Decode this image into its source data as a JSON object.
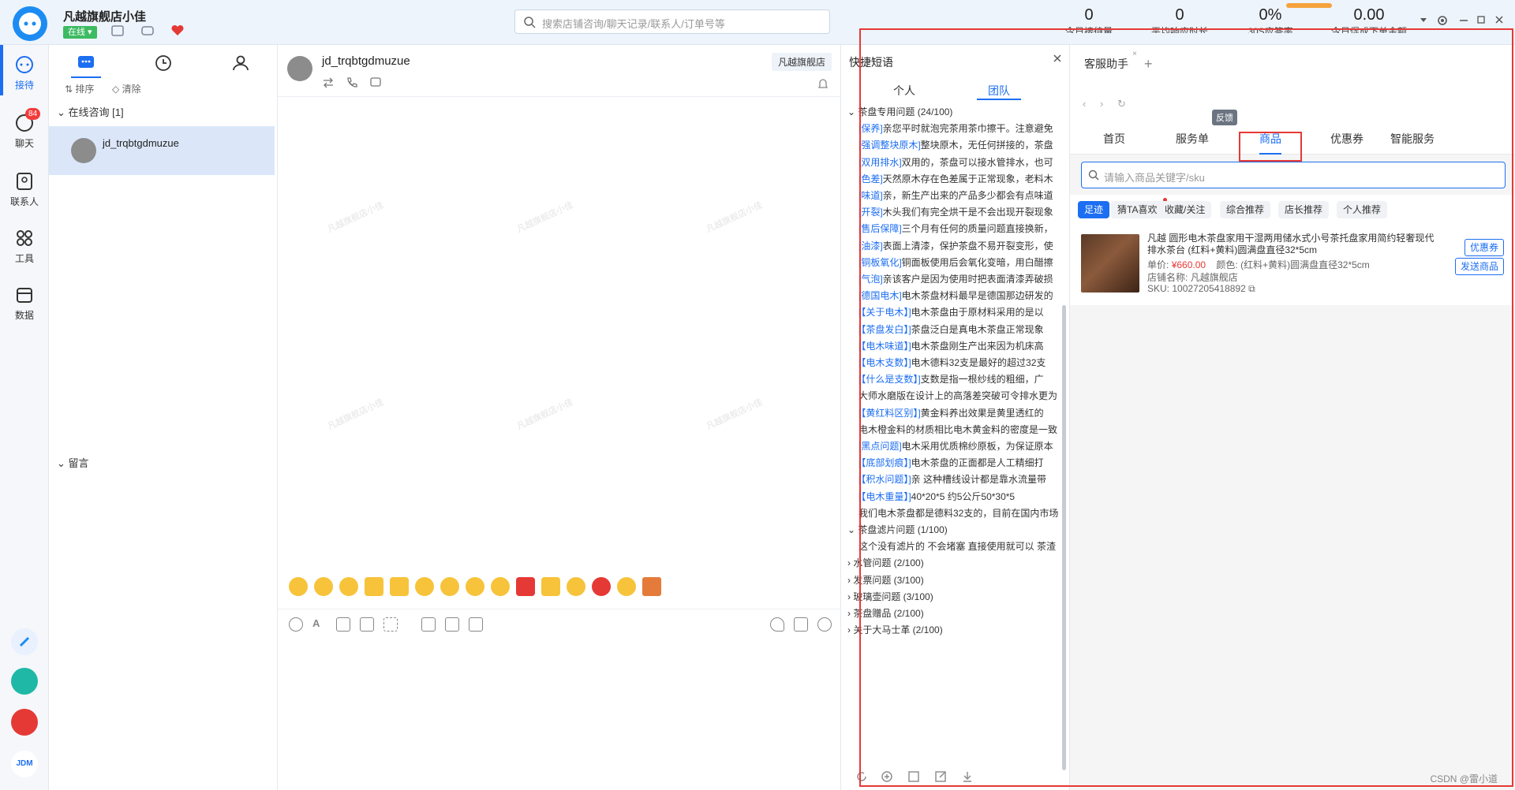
{
  "app": {
    "shop_name": "凡越旗舰店小佳",
    "status": "在线"
  },
  "search": {
    "placeholder": "搜索店铺咨询/聊天记录/联系人/订单号等"
  },
  "stats": [
    {
      "value": "0",
      "label": "今日接待量"
    },
    {
      "value": "0",
      "label": "平均响应时长"
    },
    {
      "value": "0%",
      "label": "30S应答率"
    },
    {
      "value": "0.00",
      "label": "今日促成下单金额"
    }
  ],
  "nav": [
    {
      "label": "接待",
      "icon": "chat-bubble-icon"
    },
    {
      "label": "聊天",
      "icon": "chat-icon",
      "badge": "84"
    },
    {
      "label": "联系人",
      "icon": "contact-card-icon"
    },
    {
      "label": "工具",
      "icon": "grid-icon"
    },
    {
      "label": "数据",
      "icon": "calendar-icon"
    }
  ],
  "conv_panel": {
    "sort": "排序",
    "clear": "清除",
    "online_group": "在线咨询 [1]",
    "conv_name": "jd_trqbtgdmuzue",
    "message_group": "留言"
  },
  "chat": {
    "user": "jd_trqbtgdmuzue",
    "store_tag": "凡越旗舰店",
    "watermark": "凡越旗舰店小佳"
  },
  "quick": {
    "title": "快捷短语",
    "tab_personal": "个人",
    "tab_team": "团队",
    "categories": [
      {
        "name": "茶盘专用问题 (24/100)",
        "open": true,
        "items": [
          {
            "tag": "[保养]",
            "text": "亲您平时就泡完茶用茶巾擦干。注意避免"
          },
          {
            "tag": "[强调整块原木]",
            "text": "整块原木，无任何拼接的，茶盘"
          },
          {
            "tag": "[双用排水]",
            "text": "双用的，茶盘可以接水管排水，也可"
          },
          {
            "tag": "[色差]",
            "text": "天然原木存在色差属于正常现象，老料木"
          },
          {
            "tag": "[味道]",
            "text": "亲，新生产出来的产品多少都会有点味道"
          },
          {
            "tag": "[开裂]",
            "text": "木头我们有完全烘干是不会出现开裂现象"
          },
          {
            "tag": "[售后保障]",
            "text": "三个月有任何的质量问题直接换新，"
          },
          {
            "tag": "[油漆]",
            "text": "表面上清漆，保护茶盘不易开裂变形，使"
          },
          {
            "tag": "[铜板氧化]",
            "text": "铜面板使用后会氧化变暗，用白醋擦"
          },
          {
            "tag": "[气泡]",
            "text": "亲该客户是因为使用时把表面清漆弄破损"
          },
          {
            "tag": "[德国电木]",
            "text": "电木茶盘材料最早是德国那边研发的"
          },
          {
            "tag": "[【关于电木】]",
            "text": "电木茶盘由于原材料采用的是以"
          },
          {
            "tag": "[【茶盘发白】]",
            "text": "茶盘泛白是真电木茶盘正常现象"
          },
          {
            "tag": "[【电木味道】]",
            "text": "电木茶盘刚生产出来因为机床高"
          },
          {
            "tag": "[【电木支数】]",
            "text": "电木德料32支是最好的超过32支"
          },
          {
            "tag": "[【什么是支数】]",
            "text": "支数是指一根纱线的粗细，广"
          },
          {
            "tag": "",
            "text": "大师水磨版在设计上的高落差突破可令排水更为"
          },
          {
            "tag": "[【黄红料区别】]",
            "text": "黄金料养出效果是黄里透红的"
          },
          {
            "tag": "",
            "text": "电木橙金料的材质相比电木黄金料的密度是一致"
          },
          {
            "tag": "[黑点问题]",
            "text": "电木采用优质棉纱原板，为保证原本"
          },
          {
            "tag": "[【底部划痕】]",
            "text": "电木茶盘的正面都是人工精细打"
          },
          {
            "tag": "[【积水问题】]",
            "text": "亲 这种槽线设计都是靠水流量带"
          },
          {
            "tag": "[【电木重量】]",
            "text": "40*20*5    约5公斤50*30*5"
          },
          {
            "tag": "",
            "text": "我们电木茶盘都是德料32支的，目前在国内市场"
          }
        ]
      },
      {
        "name": "茶盘滤片问题 (1/100)",
        "open": true,
        "items": [
          {
            "tag": "",
            "text": "这个没有滤片的 不会堵塞 直接使用就可以 茶渣"
          }
        ]
      },
      {
        "name": "水管问题 (2/100)",
        "open": false,
        "items": []
      },
      {
        "name": "发票问题 (3/100)",
        "open": false,
        "items": []
      },
      {
        "name": "玻璃壶问题 (3/100)",
        "open": false,
        "items": []
      },
      {
        "name": "茶盘赠品 (2/100)",
        "open": false,
        "items": []
      },
      {
        "name": "关于大马士革 (2/100)",
        "open": false,
        "items": []
      }
    ]
  },
  "helper": {
    "tab": "客服助手",
    "menu": [
      "首页",
      "服务单",
      "商品",
      "优惠券",
      "智能服务"
    ],
    "active_menu": "商品",
    "search_placeholder": "请输入商品关键字/sku",
    "filters": [
      "足迹",
      "猜TA喜欢",
      "收藏/关注",
      "综合推荐",
      "店长推荐",
      "个人推荐"
    ],
    "active_filter": "足迹",
    "feedback": "反馈",
    "product": {
      "title": "凡越 圆形电木茶盘家用干湿两用储水式小号茶托盘家用简约轻奢现代排水茶台 (红料+黄料)圆满盘直径32*5cm",
      "price_label": "单价:",
      "price": "¥660.00",
      "color_label": "颜色:",
      "color": "(红料+黄料)圆满盘直径32*5cm",
      "shop_label": "店铺名称:",
      "shop": "凡越旗舰店",
      "sku_label": "SKU:",
      "sku": "10027205418892",
      "btn_coupon": "优惠券",
      "btn_send": "发送商品"
    }
  },
  "footer": {
    "credit": "CSDN @雷小道"
  }
}
